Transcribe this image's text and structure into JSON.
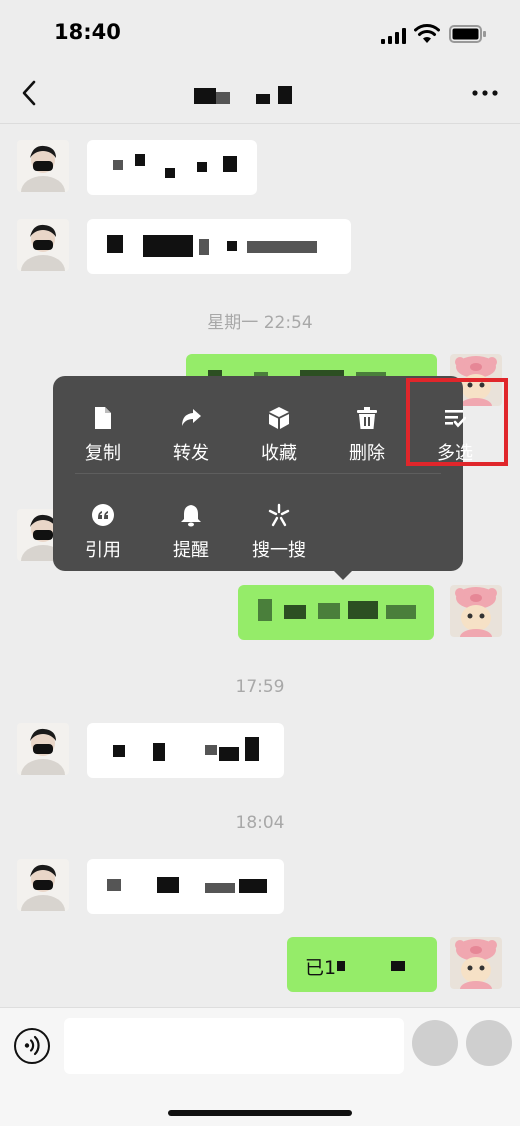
{
  "status": {
    "time": "18:40"
  },
  "timestamps": {
    "t1": "星期一 22:54",
    "t2": "17:59",
    "t3": "18:04"
  },
  "messages": {
    "last_prefix": "已1"
  },
  "menu": {
    "copy": "复制",
    "forward": "转发",
    "favorite": "收藏",
    "delete": "删除",
    "multiselect": "多选",
    "quote": "引用",
    "remind": "提醒",
    "search": "搜一搜"
  },
  "colors": {
    "background": "#ededed",
    "bubble_green": "#95ec69",
    "bubble_white": "#ffffff",
    "menu_bg": "#4c4c4c",
    "highlight_red": "#e0262b"
  },
  "icons": {
    "back": "chevron-left-icon",
    "more": "more-dots-icon",
    "copy": "document-icon",
    "forward": "share-arrow-icon",
    "favorite": "cube-icon",
    "delete": "trash-icon",
    "multiselect": "list-check-icon",
    "quote": "quote-icon",
    "remind": "bell-icon",
    "search": "sparkle-icon",
    "voice": "voice-icon"
  }
}
